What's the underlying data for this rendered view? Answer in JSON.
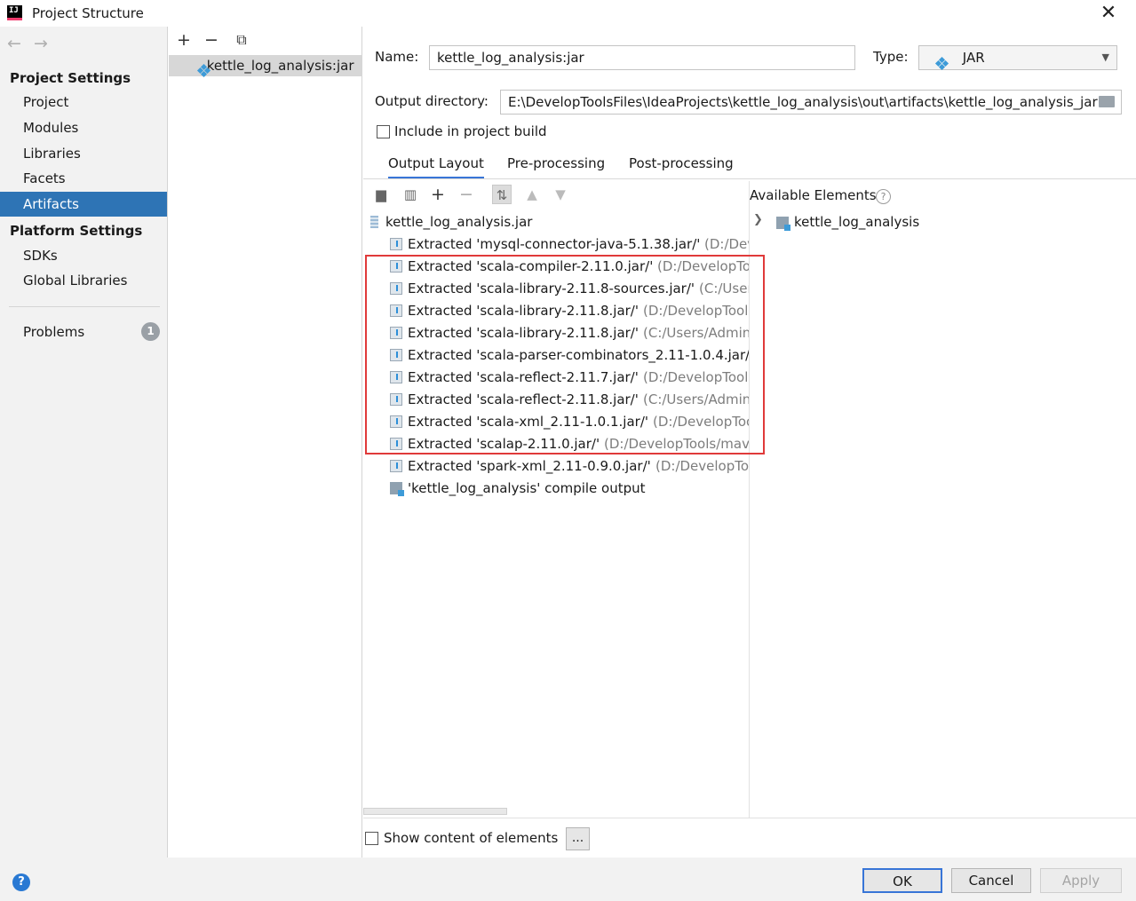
{
  "window": {
    "title": "Project Structure",
    "logo_text": "IJ",
    "close_glyph": "✕"
  },
  "nav": {
    "back_glyph": "←",
    "forward_glyph": "→",
    "project_settings_header": "Project Settings",
    "project_items": [
      "Project",
      "Modules",
      "Libraries",
      "Facets",
      "Artifacts"
    ],
    "selected": "Artifacts",
    "platform_settings_header": "Platform Settings",
    "platform_items": [
      "SDKs",
      "Global Libraries"
    ],
    "problems_label": "Problems",
    "problems_count": "1"
  },
  "artifacts": {
    "toolbar": {
      "add": "+",
      "remove": "−",
      "copy": "⧉"
    },
    "items": [
      "kettle_log_analysis:jar"
    ]
  },
  "form": {
    "name_label": "Name:",
    "name_value": "kettle_log_analysis:jar",
    "type_label": "Type:",
    "type_value": "JAR",
    "output_dir_label": "Output directory:",
    "output_dir_value": "E:\\DevelopToolsFiles\\IdeaProjects\\kettle_log_analysis\\out\\artifacts\\kettle_log_analysis_jar",
    "include_label": "Include in project build",
    "include_checked": false
  },
  "tabs": [
    "Output Layout",
    "Pre-processing",
    "Post-processing"
  ],
  "selected_tab": "Output Layout",
  "layout": {
    "root": "kettle_log_analysis.jar",
    "entries": [
      {
        "label": "Extracted 'mysql-connector-java-5.1.38.jar/'",
        "path": "(D:/Deve"
      },
      {
        "label": "Extracted 'scala-compiler-2.11.0.jar/'",
        "path": "(D:/DevelopToo"
      },
      {
        "label": "Extracted 'scala-library-2.11.8-sources.jar/'",
        "path": "(C:/Users/"
      },
      {
        "label": "Extracted 'scala-library-2.11.8.jar/'",
        "path": "(D:/DevelopTools/"
      },
      {
        "label": "Extracted 'scala-library-2.11.8.jar/'",
        "path": "(C:/Users/Administ"
      },
      {
        "label": "Extracted 'scala-parser-combinators_2.11-1.0.4.jar/'",
        "path": "("
      },
      {
        "label": "Extracted 'scala-reflect-2.11.7.jar/'",
        "path": "(D:/DevelopTools/"
      },
      {
        "label": "Extracted 'scala-reflect-2.11.8.jar/'",
        "path": "(C:/Users/Administ"
      },
      {
        "label": "Extracted 'scala-xml_2.11-1.0.1.jar/'",
        "path": "(D:/DevelopTools"
      },
      {
        "label": "Extracted 'scalap-2.11.0.jar/'",
        "path": "(D:/DevelopTools/maven"
      },
      {
        "label": "Extracted 'spark-xml_2.11-0.9.0.jar/'",
        "path": "(D:/DevelopTool"
      }
    ],
    "compile_output": "'kettle_log_analysis' compile output"
  },
  "available": {
    "header": "Available Elements",
    "help_glyph": "?",
    "items": [
      "kettle_log_analysis"
    ]
  },
  "show_content_label": "Show content of elements",
  "ellipsis": "...",
  "buttons": {
    "ok": "OK",
    "cancel": "Cancel",
    "apply": "Apply"
  },
  "help_glyph": "?",
  "colors": {
    "selection": "#2e74b5",
    "highlight_box": "#e03a3a",
    "tab_underline": "#3875d7"
  }
}
